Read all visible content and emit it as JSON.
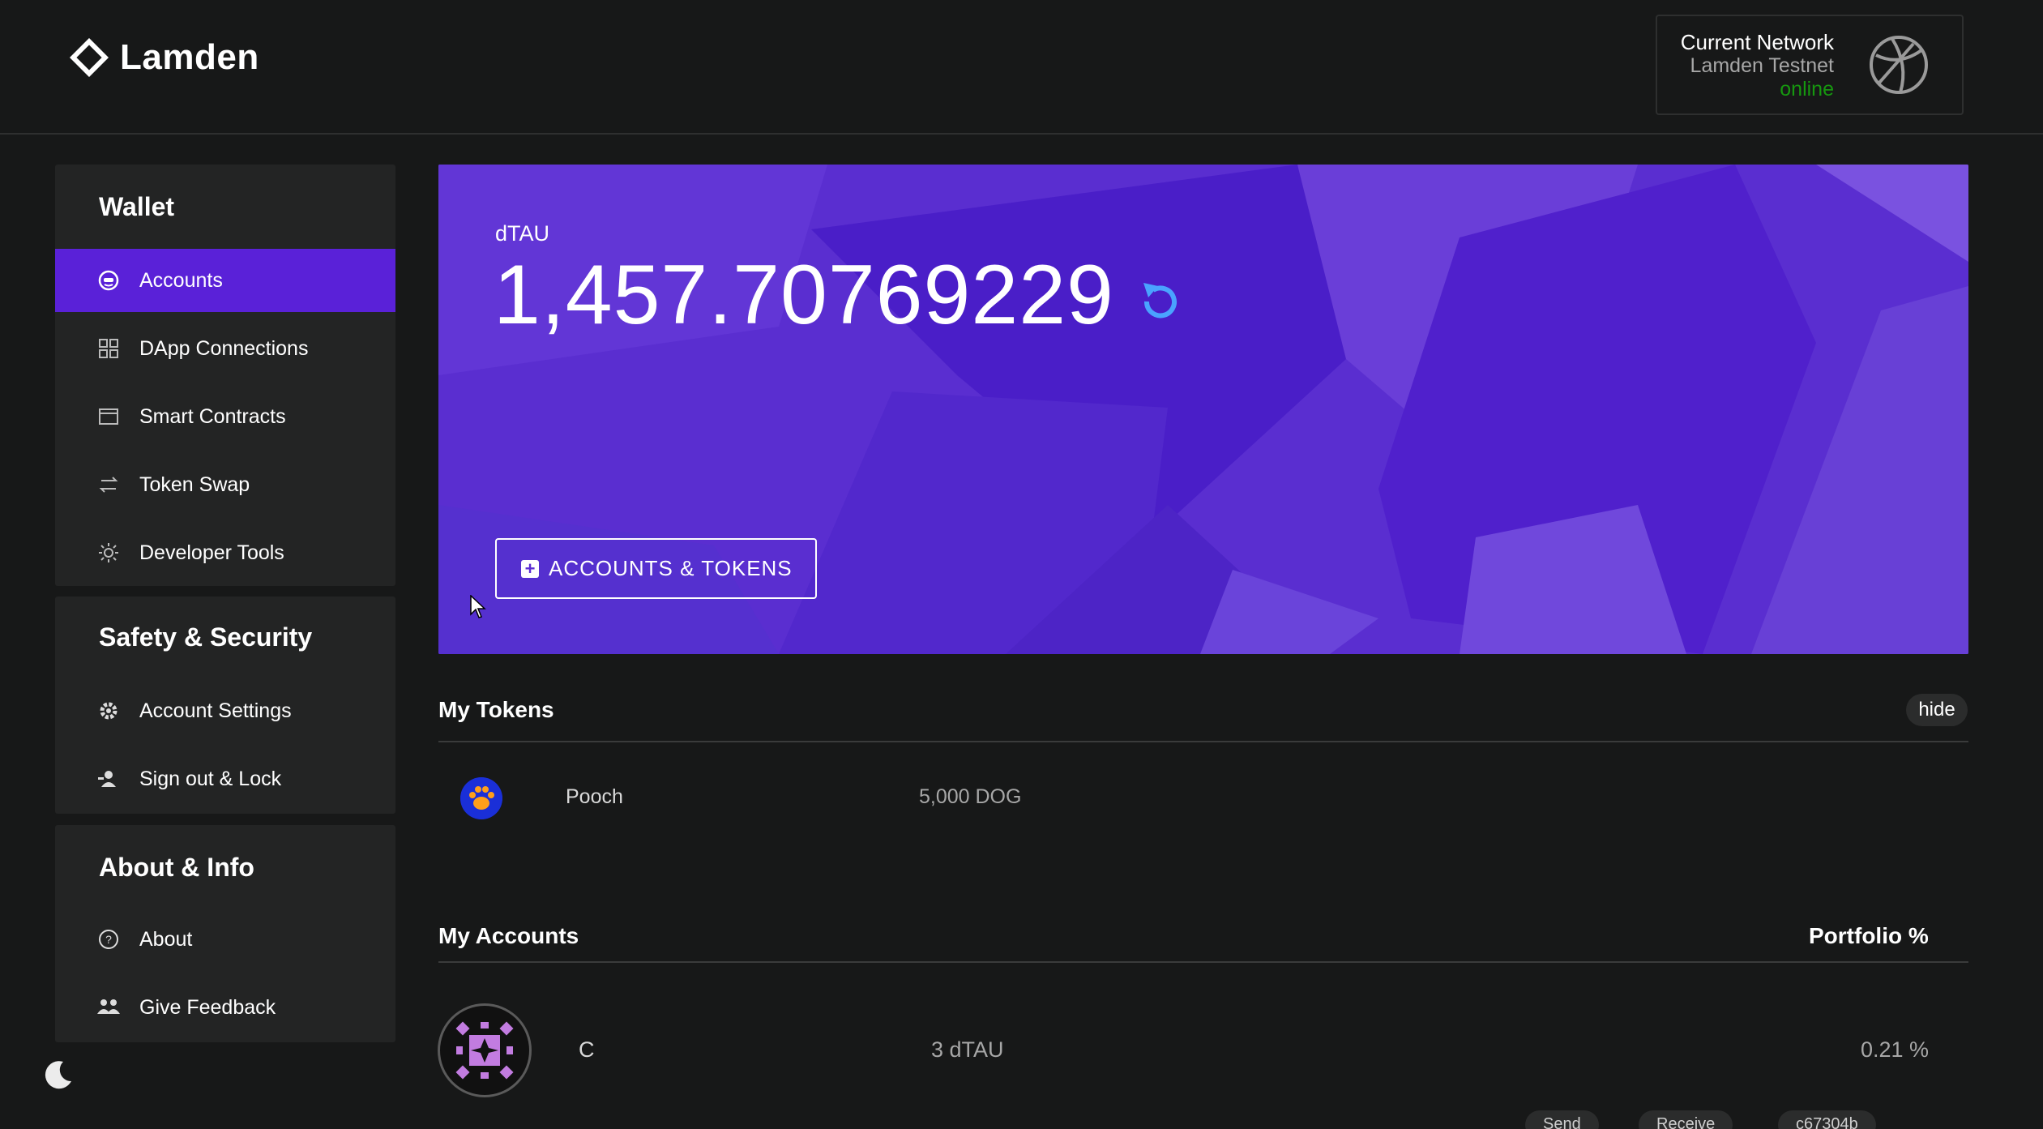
{
  "header": {
    "logo_text": "Lamden",
    "network": {
      "title": "Current Network",
      "name": "Lamden Testnet",
      "status": "online",
      "status_color": "#16970f"
    }
  },
  "sidebar": {
    "wallet": {
      "title": "Wallet",
      "items": [
        {
          "label": "Accounts",
          "icon": "accounts-icon",
          "active": true
        },
        {
          "label": "DApp Connections",
          "icon": "grid-icon"
        },
        {
          "label": "Smart Contracts",
          "icon": "window-icon"
        },
        {
          "label": "Token Swap",
          "icon": "swap-icon"
        },
        {
          "label": "Developer Tools",
          "icon": "lightbulb-icon"
        }
      ]
    },
    "security": {
      "title": "Safety & Security",
      "items": [
        {
          "label": "Account Settings",
          "icon": "gear-icon"
        },
        {
          "label": "Sign out & Lock",
          "icon": "sign-out-icon"
        }
      ]
    },
    "about": {
      "title": "About & Info",
      "items": [
        {
          "label": "About",
          "icon": "question-icon"
        },
        {
          "label": "Give Feedback",
          "icon": "people-icon"
        }
      ]
    }
  },
  "banner": {
    "token_symbol": "dTAU",
    "balance": "1,457.70769229",
    "button_label": "ACCOUNTS & TOKENS",
    "accent_color": "#5b2dd3"
  },
  "tokens": {
    "title": "My Tokens",
    "hide_label": "hide",
    "rows": [
      {
        "name": "Pooch",
        "amount": "5,000 DOG",
        "icon": "paw-icon"
      }
    ]
  },
  "accounts": {
    "title": "My Accounts",
    "portfolio_header": "Portfolio %",
    "rows": [
      {
        "name": "C",
        "amount": "3 dTAU",
        "portfolio": "0.21 %"
      }
    ],
    "actions": [
      "Send",
      "Receive",
      "c67304b"
    ]
  }
}
